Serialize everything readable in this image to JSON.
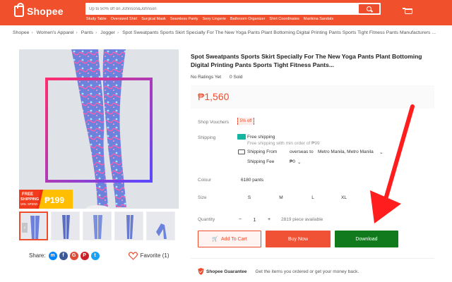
{
  "header": {
    "logo_text": "Shopee",
    "search_placeholder": "Up to 50% off on Johnson&Johnson",
    "keywords": [
      "Study Table",
      "Oversized Shirt",
      "Surgical Mask",
      "Seamless Panty",
      "Sexy Lingerie",
      "Bathroom Organizer",
      "Shirt Coordinates",
      "Marikina Sandals"
    ],
    "accent_color": "#f0512c"
  },
  "breadcrumb": [
    "Shopee",
    "Women's Apparel",
    "Pants",
    "Jogger",
    "Spot Sweatpants Sports Skirt Specially For The New Yoga Pants Plant Bottoming Digital Printing Pants Sports Tight Fitness Pants Manufacturers ..."
  ],
  "product": {
    "title": "Spot Sweatpants Sports Skirt Specially For The New Yoga Pants Plant Bottoming Digital Printing Pants Sports Tight Fitness Pants...",
    "ratings": "No Ratings Yet",
    "sold_count": "0",
    "sold_label": "Sold",
    "price": "₱1,560",
    "shop_vouchers_label": "Shop Vouchers",
    "voucher_badge": "5% off",
    "shipping_label": "Shipping",
    "free_shipping_label": "Free shipping",
    "free_shipping_note": "Free shipping with min order of ₱99",
    "shipping_from_label": "Shipping From",
    "shipping_from_value": "overseas to",
    "destination": "Metro Manila, Metro Manila",
    "shipping_fee_label": "Shipping Fee",
    "shipping_fee_value": "₱0",
    "colour_label": "Colour",
    "colour_value": "6180 pants",
    "size_label": "Size",
    "sizes": [
      "S",
      "M",
      "L",
      "XL"
    ],
    "quantity_label": "Quantity",
    "quantity_value": "1",
    "stock_text": "2819 piece available",
    "add_to_cart": "Add To Cart",
    "buy_now": "Buy Now",
    "download": "Download",
    "share_label": "Share:",
    "favorite_label": "Favorite (1)",
    "guarantee_title": "Shopee Guarantee",
    "guarantee_text": "Get the items you ordered or get your money back.",
    "promo_line1": "FREE",
    "promo_line2": "SHIPPING",
    "promo_line3": "MIN. SPEND",
    "promo_amount": "₱199"
  },
  "colors": {
    "primary": "#ee4d2d",
    "download": "#107a1c",
    "arrow": "#ff1d1d"
  }
}
